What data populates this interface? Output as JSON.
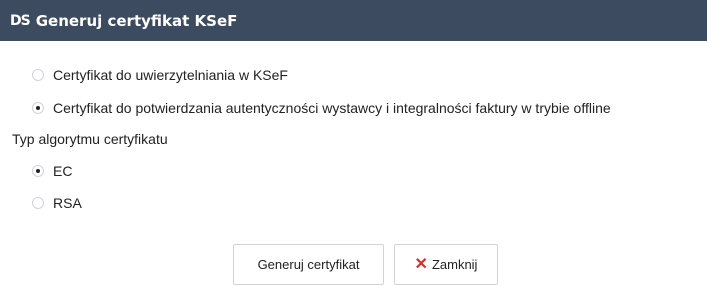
{
  "dialog": {
    "logo_text": "DS",
    "title": "Generuj certyfikat KSeF"
  },
  "certificate_type": {
    "options": [
      {
        "label": "Certyfikat do uwierzytelniania w KSeF",
        "selected": false
      },
      {
        "label": "Certyfikat do potwierdzania autentyczności wystawcy i integralności faktury w trybie offline",
        "selected": true
      }
    ]
  },
  "algorithm": {
    "label": "Typ algorytmu certyfikatu",
    "options": [
      {
        "label": "EC",
        "selected": true
      },
      {
        "label": "RSA",
        "selected": false
      }
    ]
  },
  "footer": {
    "generate_label": "Generuj certyfikat",
    "close_label": "Zamknij"
  },
  "colors": {
    "titlebar": "#3d4b60",
    "close_icon": "#d32f2f"
  },
  "icons": {
    "close": "close-icon",
    "logo": "ds-logo-icon"
  }
}
